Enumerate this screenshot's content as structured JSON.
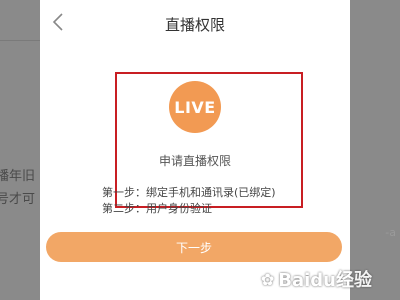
{
  "background": {
    "left_text_1": "播年旧",
    "left_text_2": "号才可",
    "right_text": "-a"
  },
  "modal": {
    "title": "直播权限",
    "back_icon": "chevron-left-icon",
    "badge_text": "LIVE",
    "apply_label": "申请直播权限",
    "steps": [
      "第一步：绑定手机和通讯录(已绑定)",
      "第二步：用户身份验证"
    ],
    "next_button": "下一步"
  },
  "watermark": {
    "brand": "Baidu经验"
  },
  "colors": {
    "accent_orange": "#f29a53",
    "button_orange": "#f2a766",
    "highlight_red": "#c81e23",
    "overlay_gray": "#8a8a8a"
  }
}
